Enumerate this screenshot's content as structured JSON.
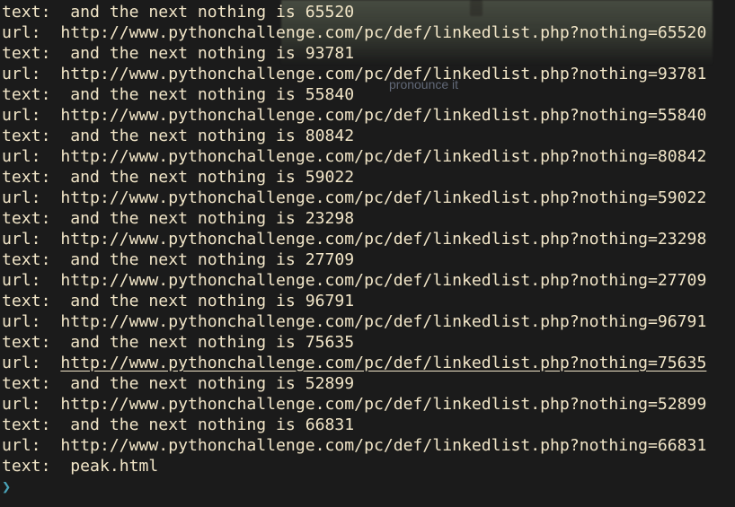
{
  "overlay": {
    "text": "pronounce it"
  },
  "lines": [
    {
      "label": "text:  ",
      "value": "and the next nothing is 65520"
    },
    {
      "label": "url:  ",
      "value": "http://www.pythonchallenge.com/pc/def/linkedlist.php?nothing=65520"
    },
    {
      "label": "text:  ",
      "value": "and the next nothing is 93781"
    },
    {
      "label": "url:  ",
      "value": "http://www.pythonchallenge.com/pc/def/linkedlist.php?nothing=93781"
    },
    {
      "label": "text:  ",
      "value": "and the next nothing is 55840"
    },
    {
      "label": "url:  ",
      "value": "http://www.pythonchallenge.com/pc/def/linkedlist.php?nothing=55840"
    },
    {
      "label": "text:  ",
      "value": "and the next nothing is 80842"
    },
    {
      "label": "url:  ",
      "value": "http://www.pythonchallenge.com/pc/def/linkedlist.php?nothing=80842"
    },
    {
      "label": "text:  ",
      "value": "and the next nothing is 59022"
    },
    {
      "label": "url:  ",
      "value": "http://www.pythonchallenge.com/pc/def/linkedlist.php?nothing=59022"
    },
    {
      "label": "text:  ",
      "value": "and the next nothing is 23298"
    },
    {
      "label": "url:  ",
      "value": "http://www.pythonchallenge.com/pc/def/linkedlist.php?nothing=23298"
    },
    {
      "label": "text:  ",
      "value": "and the next nothing is 27709"
    },
    {
      "label": "url:  ",
      "value": "http://www.pythonchallenge.com/pc/def/linkedlist.php?nothing=27709"
    },
    {
      "label": "text:  ",
      "value": "and the next nothing is 96791"
    },
    {
      "label": "url:  ",
      "value": "http://www.pythonchallenge.com/pc/def/linkedlist.php?nothing=96791"
    },
    {
      "label": "text:  ",
      "value": "and the next nothing is 75635"
    },
    {
      "label": "url:  ",
      "value": "http://www.pythonchallenge.com/pc/def/linkedlist.php?nothing=75635"
    },
    {
      "label": "text:  ",
      "value": "and the next nothing is 52899"
    },
    {
      "label": "url:  ",
      "value": "http://www.pythonchallenge.com/pc/def/linkedlist.php?nothing=52899"
    },
    {
      "label": "text:  ",
      "value": "and the next nothing is 66831"
    },
    {
      "label": "url:  ",
      "value": "http://www.pythonchallenge.com/pc/def/linkedlist.php?nothing=66831"
    },
    {
      "label": "text:  ",
      "value": "peak.html"
    }
  ],
  "prompt": {
    "symbol": "❯"
  },
  "colors": {
    "background": "#1b1b1b",
    "foreground": "#f2e6c8",
    "prompt": "#4aa3b8"
  }
}
